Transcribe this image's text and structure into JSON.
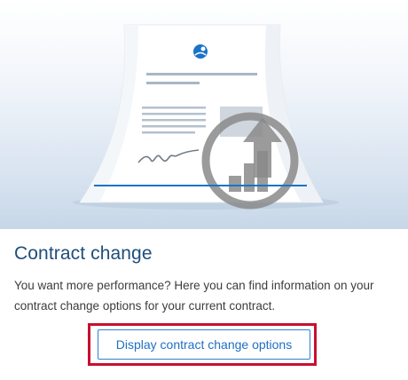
{
  "card": {
    "title": "Contract change",
    "description": "You want more performance? Here you can find information on your contract change options for your current contract.",
    "button_label": "Display contract change options"
  },
  "illustration": {
    "icons": [
      "document-icon",
      "logo-icon",
      "signature-icon",
      "upgrade-arrow-icon"
    ]
  },
  "colors": {
    "title": "#1f4e79",
    "button_border": "#2f80d0",
    "button_text": "#1f6fc4",
    "highlight": "#c8102e",
    "hero_gradient_end": "#c7d7e8"
  }
}
